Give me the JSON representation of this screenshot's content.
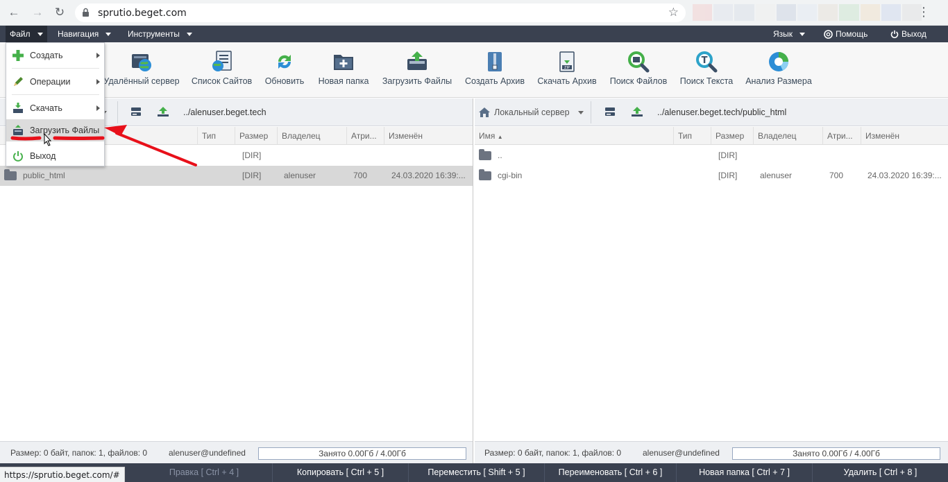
{
  "browser": {
    "url": "sprutio.beget.com",
    "status_url": "https://sprutio.beget.com/#"
  },
  "menubar": {
    "file": "Файл",
    "navigation": "Навигация",
    "tools": "Инструменты",
    "language": "Язык",
    "help": "Помощь",
    "exit": "Выход"
  },
  "toolbar": [
    {
      "label": "Удалённый сервер",
      "icon": "remote-server-icon"
    },
    {
      "label": "Список Сайтов",
      "icon": "site-list-icon"
    },
    {
      "label": "Обновить",
      "icon": "refresh-icon"
    },
    {
      "label": "Новая папка",
      "icon": "new-folder-icon"
    },
    {
      "label": "Загрузить Файлы",
      "icon": "upload-files-icon"
    },
    {
      "label": "Создать Архив",
      "icon": "create-archive-icon"
    },
    {
      "label": "Скачать Архив",
      "icon": "download-archive-icon"
    },
    {
      "label": "Поиск Файлов",
      "icon": "search-files-icon"
    },
    {
      "label": "Поиск Текста",
      "icon": "search-text-icon"
    },
    {
      "label": "Анализ Размера",
      "icon": "size-analysis-icon"
    }
  ],
  "file_menu": {
    "items": [
      {
        "label": "Создать",
        "icon": "plus-icon"
      },
      {
        "label": "Операции",
        "icon": "pencil-icon"
      },
      {
        "label": "Скачать",
        "icon": "download-icon"
      },
      {
        "label": "Загрузить Файлы",
        "icon": "upload-icon"
      },
      {
        "label": "Выход",
        "icon": "power-icon"
      }
    ]
  },
  "left_panel": {
    "path": "../alenuser.beget.tech",
    "columns": [
      "Тип",
      "Размер",
      "Владелец",
      "Атри...",
      "Изменён"
    ],
    "rows": [
      {
        "name": "",
        "type": "",
        "size": "[DIR]",
        "owner": "",
        "attr": "",
        "modified": ""
      },
      {
        "name": "public_html",
        "type": "",
        "size": "[DIR]",
        "owner": "alenuser",
        "attr": "700",
        "modified": "24.03.2020 16:39:..."
      }
    ],
    "status": "Размер: 0 байт, папок: 1, файлов: 0",
    "user": "alenuser@undefined",
    "quota": "Занято 0.00Гб / 4.00Гб"
  },
  "right_panel": {
    "server": "Локальный сервер",
    "path": "../alenuser.beget.tech/public_html",
    "columns": [
      "Имя",
      "Тип",
      "Размер",
      "Владелец",
      "Атри...",
      "Изменён"
    ],
    "rows": [
      {
        "name": "..",
        "type": "",
        "size": "[DIR]",
        "owner": "",
        "attr": "",
        "modified": ""
      },
      {
        "name": "cgi-bin",
        "type": "",
        "size": "[DIR]",
        "owner": "alenuser",
        "attr": "700",
        "modified": "24.03.2020 16:39:..."
      }
    ],
    "status": "Размер: 0 байт, папок: 1, файлов: 0",
    "user": "alenuser@undefined",
    "quota": "Занято 0.00Гб / 4.00Гб"
  },
  "hotkeys": [
    "Правка [ Ctrl + 4 ]",
    "Копировать [ Ctrl + 5 ]",
    "Переместить [ Shift + 5 ]",
    "Переименовать [ Ctrl + 6 ]",
    "Новая папка [ Ctrl + 7 ]",
    "Удалить [ Ctrl + 8 ]"
  ],
  "colors": {
    "menubar": "#3a4150",
    "annotation": "#e8101a",
    "hover": "#dcdcdc"
  }
}
